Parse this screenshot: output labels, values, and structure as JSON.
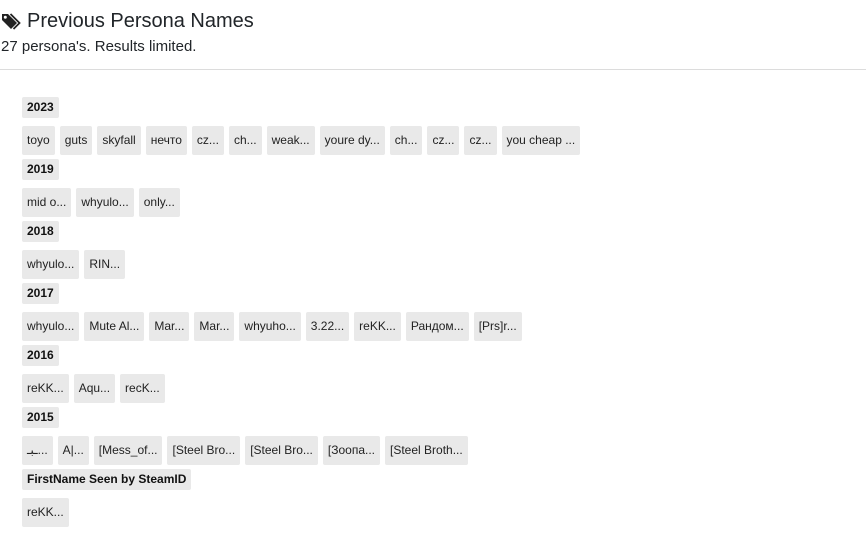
{
  "header": {
    "title": "Previous Persona Names",
    "subtitle": "27 persona's. Results limited."
  },
  "groups": [
    {
      "label": "2023",
      "names": [
        "toyo",
        "guts",
        "skyfall",
        "нечто",
        "cz...",
        "ch...",
        "weak...",
        "youre dy...",
        "ch...",
        "cz...",
        "cz...",
        "you cheap ..."
      ]
    },
    {
      "label": "2019",
      "names": [
        "mid o...",
        "whyulo...",
        "only..."
      ]
    },
    {
      "label": "2018",
      "names": [
        "whyulo...",
        "RIN..."
      ]
    },
    {
      "label": "2017",
      "names": [
        "whyulo...",
        "Mute Al...",
        "Mar...",
        "Mar...",
        "whyuho...",
        "3.22...",
        "reKK...",
        "Рандом...",
        "[Prs]r..."
      ]
    },
    {
      "label": "2016",
      "names": [
        "reKK...",
        "Aqu...",
        "recK..."
      ]
    },
    {
      "label": "2015",
      "names": [
        "ـبـ...",
        "A|...",
        "[Mess_of...",
        "[Steel Bro...",
        "[Steel Bro...",
        "[Зоопа...",
        "[Steel Broth..."
      ]
    },
    {
      "label": "FirstName Seen by SteamID",
      "names": [
        "reKK..."
      ]
    }
  ]
}
